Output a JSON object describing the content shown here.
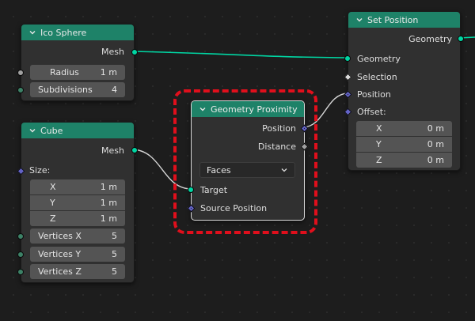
{
  "colors": {
    "node_header": "#1e8268",
    "node_body": "#303030",
    "field_bg": "#545454",
    "geometry_socket": "#00d6a3",
    "vector_socket": "#6363c7",
    "float_socket": "#a1a1a1",
    "int_socket": "#3d8267",
    "wire": "#00d6a3",
    "vector_wire": "#d9d9d9",
    "highlight": "#e00f1c",
    "canvas": "#1d1d1d"
  },
  "ico_sphere": {
    "title": "Ico Sphere",
    "output_mesh": "Mesh",
    "radius_label": "Radius",
    "radius_value": "1 m",
    "subdivisions_label": "Subdivisions",
    "subdivisions_value": "4"
  },
  "cube": {
    "title": "Cube",
    "output_mesh": "Mesh",
    "size_label": "Size:",
    "x_label": "X",
    "x_value": "1 m",
    "y_label": "Y",
    "y_value": "1 m",
    "z_label": "Z",
    "z_value": "1 m",
    "vertices_x_label": "Vertices X",
    "vertices_x_value": "5",
    "vertices_y_label": "Vertices Y",
    "vertices_y_value": "5",
    "vertices_z_label": "Vertices Z",
    "vertices_z_value": "5"
  },
  "geometry_proximity": {
    "title": "Geometry Proximity",
    "output_position": "Position",
    "output_distance": "Distance",
    "mode_selected": "Faces",
    "input_target": "Target",
    "input_source_position": "Source Position"
  },
  "set_position": {
    "title": "Set Position",
    "output_geometry": "Geometry",
    "input_geometry": "Geometry",
    "input_selection": "Selection",
    "input_position": "Position",
    "input_offset": "Offset:",
    "offset_x_label": "X",
    "offset_x_value": "0 m",
    "offset_y_label": "Y",
    "offset_y_value": "0 m",
    "offset_z_label": "Z",
    "offset_z_value": "0 m"
  },
  "icons": {
    "collapse": "chevron-down-icon",
    "dropdown": "chevron-down-icon"
  }
}
